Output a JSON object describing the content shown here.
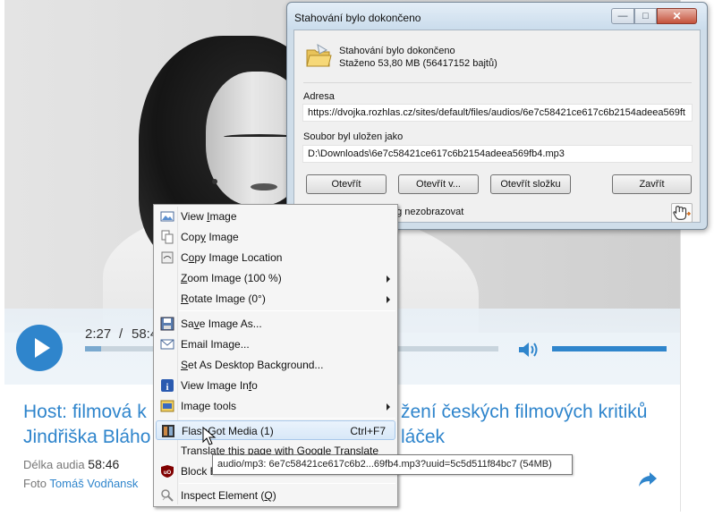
{
  "player": {
    "current_time": "2:27",
    "separator": "/",
    "total_time": "58:4",
    "progress": 0.04,
    "volume": 1.0
  },
  "article": {
    "headline_line1_left": "Host: filmová k",
    "headline_line1_right": "žení českých filmových kritiků",
    "headline_line2_left": "Jindřiška Bláho",
    "headline_line2_right": "láček",
    "duration_label": "Délka audia",
    "duration_value": "58:46",
    "photo_label": "Foto",
    "photo_author": "Tomáš Vodňansk"
  },
  "dialog": {
    "title": "Stahování bylo dokončeno",
    "status": "Stahování bylo dokončeno",
    "downloaded": "Staženo 53,80  MB (56417152 bajtů)",
    "address_label": "Adresa",
    "address_value": "https://dvojka.rozhlas.cz/sites/default/files/audios/6e7c58421ce617c6b2154adeea569ft",
    "saved_label": "Soubor byl uložen jako",
    "saved_value": "D:\\Downloads\\6e7c58421ce617c6b2154adeea569fb4.mp3",
    "buttons": {
      "open": "Otevřít",
      "open_with": "Otevřít v...",
      "open_folder": "Otevřít složku",
      "close": "Zavřít"
    },
    "checkbox_label": "og nezobrazovat"
  },
  "context_menu": {
    "items": [
      {
        "label": "View Image",
        "underline": "I",
        "icon": "image-icon"
      },
      {
        "label": "Copy Image",
        "underline": "y",
        "icon": "copy-icon"
      },
      {
        "label": "Copy Image Location",
        "underline": "o",
        "icon": "copy-location-icon"
      },
      {
        "label": "Zoom Image (100 %)",
        "underline": "Z",
        "submenu": true
      },
      {
        "label": "Rotate Image (0°)",
        "underline": "R",
        "submenu": true
      },
      {
        "label": "Save Image As...",
        "underline": "v",
        "icon": "save-image-icon"
      },
      {
        "label": "Email Image...",
        "underline": "g",
        "icon": "email-icon"
      },
      {
        "label": "Set As Desktop Background...",
        "underline": "S"
      },
      {
        "label": "View Image Info",
        "underline": "f",
        "icon": "info-icon"
      },
      {
        "label": "Image tools",
        "submenu": true,
        "icon": "image-tools-icon"
      },
      {
        "label": "FlashGot Media (1)",
        "shortcut": "Ctrl+F7",
        "icon": "flashgot-icon"
      },
      {
        "label": "Translate this page with Google Translate"
      },
      {
        "label": "Block Element",
        "icon": "ublock-icon"
      },
      {
        "label": "Inspect Element (Q)",
        "underline": "Q",
        "icon": "inspect-icon"
      }
    ]
  },
  "tooltip": "audio/mp3: 6e7c58421ce617c6b2...69fb4.mp3?uuid=5c5d511f84bc7 (54MB)",
  "colors": {
    "accent": "#2f85cc",
    "dialog_frame": "#cfdde9",
    "menu_background": "#f5f5f5",
    "menu_highlight": "#d8e8f8"
  }
}
